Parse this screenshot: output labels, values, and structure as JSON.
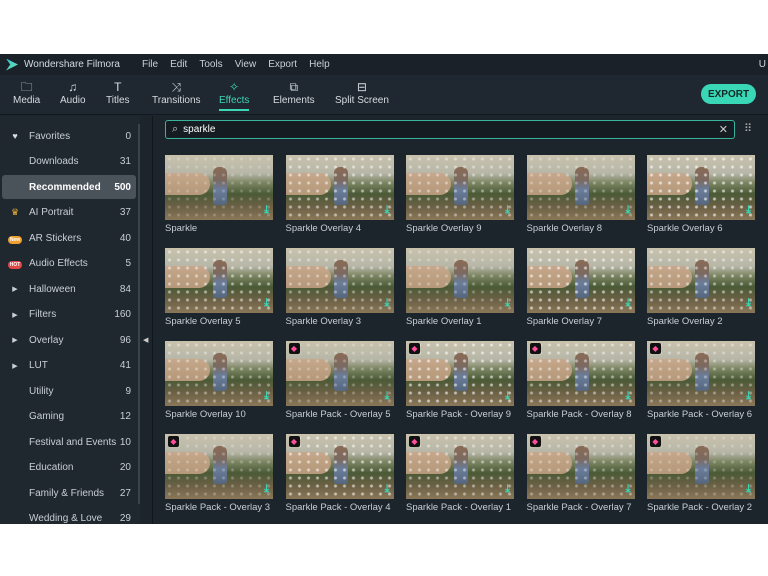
{
  "app": {
    "title": "Wondershare Filmora",
    "menu": [
      "File",
      "Edit",
      "Tools",
      "View",
      "Export",
      "Help"
    ],
    "user_initial": "U"
  },
  "toolbar": {
    "tabs": [
      {
        "label": "Media",
        "icon": "folder-icon"
      },
      {
        "label": "Audio",
        "icon": "music-icon"
      },
      {
        "label": "Titles",
        "icon": "text-icon"
      },
      {
        "label": "Transitions",
        "icon": "transitions-icon"
      },
      {
        "label": "Effects",
        "icon": "effects-icon",
        "active": true
      },
      {
        "label": "Elements",
        "icon": "elements-icon"
      },
      {
        "label": "Split Screen",
        "icon": "split-screen-icon"
      }
    ],
    "export_label": "EXPORT"
  },
  "colors": {
    "accent": "#3ad7b6",
    "new_badge": "#f0a030",
    "hot_badge": "#e04848",
    "premium": "#ff4f9a"
  },
  "sidebar": {
    "items": [
      {
        "label": "Favorites",
        "count": "0",
        "badge": "heart"
      },
      {
        "label": "Downloads",
        "count": "31"
      },
      {
        "label": "Recommended",
        "count": "500",
        "active": true
      },
      {
        "label": "AI Portrait",
        "count": "37",
        "badge": "crown"
      },
      {
        "label": "AR Stickers",
        "count": "40",
        "badge": "New"
      },
      {
        "label": "Audio Effects",
        "count": "5",
        "badge": "HOT"
      },
      {
        "label": "Halloween",
        "count": "84",
        "badge": "arrow"
      },
      {
        "label": "Filters",
        "count": "160",
        "badge": "arrow"
      },
      {
        "label": "Overlay",
        "count": "96",
        "badge": "arrow"
      },
      {
        "label": "LUT",
        "count": "41",
        "badge": "arrow"
      },
      {
        "label": "Utility",
        "count": "9"
      },
      {
        "label": "Gaming",
        "count": "12"
      },
      {
        "label": "Festival and Events",
        "count": "10"
      },
      {
        "label": "Education",
        "count": "20"
      },
      {
        "label": "Family & Friends",
        "count": "27"
      },
      {
        "label": "Wedding & Love",
        "count": "29"
      }
    ]
  },
  "search": {
    "value": "sparkle"
  },
  "effects": [
    {
      "name": "Sparkle",
      "premium": false
    },
    {
      "name": "Sparkle Overlay 4",
      "premium": false
    },
    {
      "name": "Sparkle Overlay 9",
      "premium": false
    },
    {
      "name": "Sparkle Overlay 8",
      "premium": false
    },
    {
      "name": "Sparkle Overlay 6",
      "premium": false
    },
    {
      "name": "Sparkle Overlay 5",
      "premium": false
    },
    {
      "name": "Sparkle Overlay 3",
      "premium": false
    },
    {
      "name": "Sparkle Overlay 1",
      "premium": false
    },
    {
      "name": "Sparkle Overlay 7",
      "premium": false
    },
    {
      "name": "Sparkle Overlay 2",
      "premium": false
    },
    {
      "name": "Sparkle Overlay 10",
      "premium": false
    },
    {
      "name": "Sparkle Pack - Overlay 5",
      "premium": true
    },
    {
      "name": "Sparkle Pack - Overlay 9",
      "premium": true
    },
    {
      "name": "Sparkle Pack - Overlay 8",
      "premium": true
    },
    {
      "name": "Sparkle Pack - Overlay 6",
      "premium": true
    },
    {
      "name": "Sparkle Pack - Overlay 3",
      "premium": true
    },
    {
      "name": "Sparkle Pack - Overlay 4",
      "premium": true
    },
    {
      "name": "Sparkle Pack - Overlay 1",
      "premium": true
    },
    {
      "name": "Sparkle Pack - Overlay 7",
      "premium": true
    },
    {
      "name": "Sparkle Pack - Overlay 2",
      "premium": true
    }
  ]
}
